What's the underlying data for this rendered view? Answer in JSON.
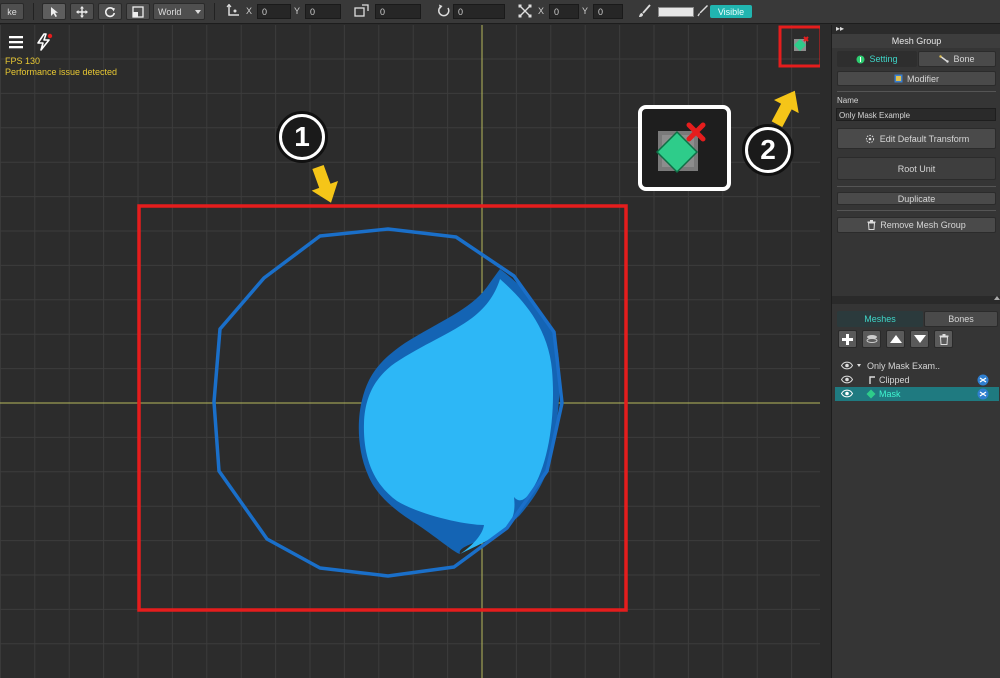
{
  "toolbar": {
    "make_label": "ke",
    "space_select": "World",
    "pos": {
      "x_label": "X",
      "x": "0",
      "y_label": "Y",
      "y": "0"
    },
    "size": {
      "value": "0"
    },
    "rotation": {
      "value": "0"
    },
    "scale": {
      "x_label": "X",
      "x": "0",
      "y_label": "Y",
      "y": "0"
    },
    "visible_label": "Visible"
  },
  "viewport": {
    "fps": "FPS 130",
    "perf_warning": "Performance issue detected",
    "callout_1": "1",
    "callout_2": "2"
  },
  "panel": {
    "title": "Mesh Group",
    "tabs": {
      "setting": "Setting",
      "bone": "Bone"
    },
    "modifier_label": "Modifier",
    "name_label": "Name",
    "name_value": "Only Mask Example",
    "edit_default_transform": "Edit Default Transform",
    "root_unit": "Root Unit",
    "duplicate": "Duplicate",
    "remove_mesh_group": "Remove Mesh Group",
    "list_tabs": {
      "meshes": "Meshes",
      "bones": "Bones"
    },
    "tree": {
      "root": "Only Mask Exam..",
      "items": [
        {
          "label": "Clipped"
        },
        {
          "label": "Mask"
        }
      ]
    }
  },
  "colors": {
    "accent_teal": "#21b5b0",
    "selection": "#1f7a80",
    "highlight_red": "#e51d1d",
    "arrow_yellow": "#f5c518",
    "mesh_outline": "#1a6fc9",
    "mask_fill": "#2bb6f5"
  }
}
